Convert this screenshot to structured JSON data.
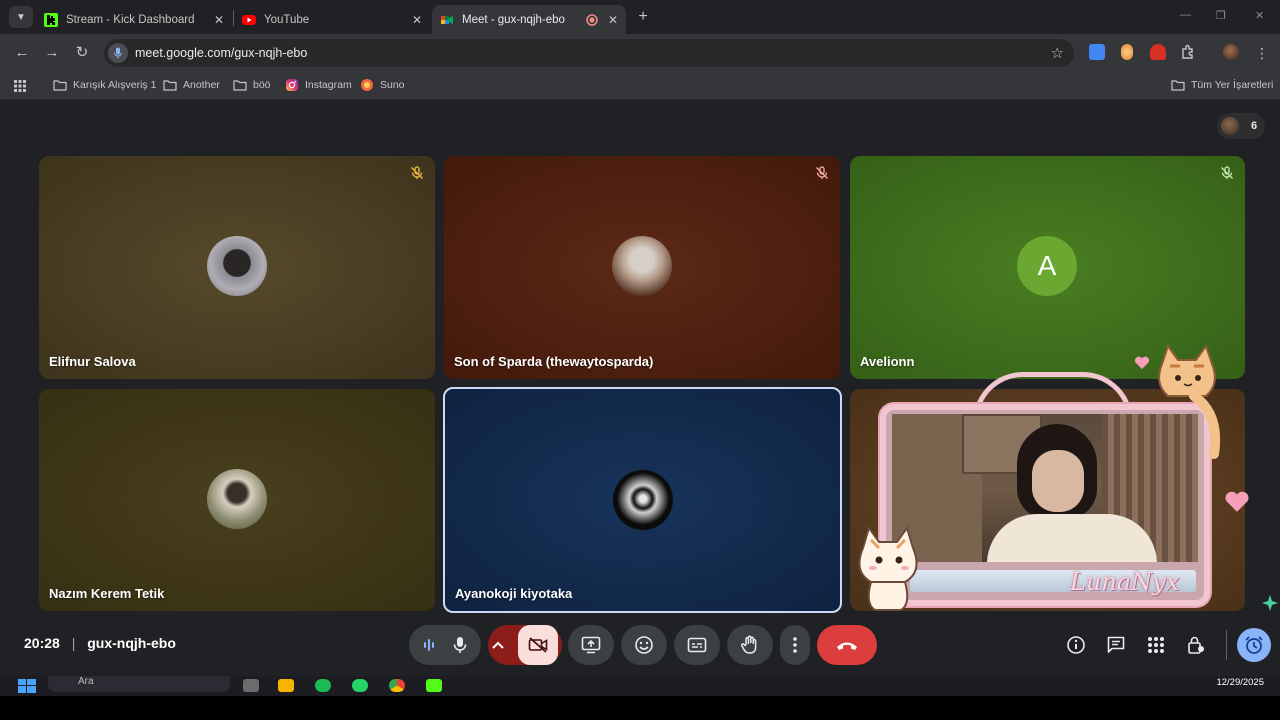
{
  "browser": {
    "tabs": [
      {
        "title": "Stream - Kick Dashboard",
        "favicon": "kick-icon",
        "color": "#53fc18"
      },
      {
        "title": "YouTube",
        "favicon": "youtube-icon",
        "color": "#ff0000"
      },
      {
        "title": "Meet - gux-nqjh-ebo",
        "favicon": "meet-icon",
        "recording": true
      }
    ],
    "url": "meet.google.com/gux-nqjh-ebo",
    "bookmarks": [
      {
        "label": "Karışık Alışveriş 1",
        "icon": "folder-icon"
      },
      {
        "label": "Another",
        "icon": "folder-icon"
      },
      {
        "label": "böö",
        "icon": "folder-icon"
      },
      {
        "label": "Instagram",
        "icon": "instagram-icon"
      },
      {
        "label": "Suno",
        "icon": "suno-icon"
      }
    ],
    "all_bookmarks": "Tüm Yer İşaretleri"
  },
  "meet": {
    "participant_count": "6",
    "tiles": [
      {
        "name": "Elifnur Salova",
        "bg": "#4a3d22",
        "muted": true,
        "avatar": "photo"
      },
      {
        "name": "Son of Sparda (thewaytosparda)",
        "bg": "#4f2112",
        "muted": true,
        "avatar": "photo"
      },
      {
        "name": "Avelionn",
        "bg": "#3f6e1b",
        "muted": true,
        "avatar": "letter",
        "letter": "A",
        "avatar_color": "#6aa832"
      },
      {
        "name": "Nazım Kerem Tetik",
        "bg": "#3b3415",
        "muted": false,
        "avatar": "photo"
      },
      {
        "name": "Ayanokoji kiyotaka",
        "bg": "#14294a",
        "muted": false,
        "avatar": "photo",
        "speaking": true
      }
    ],
    "overlay_text": "LunaNyx",
    "time": "20:28",
    "meeting_code": "gux-nqjh-ebo",
    "hangup_color": "#dc3e3e"
  },
  "taskbar": {
    "search": "Ara",
    "date": "12/29/2025"
  }
}
